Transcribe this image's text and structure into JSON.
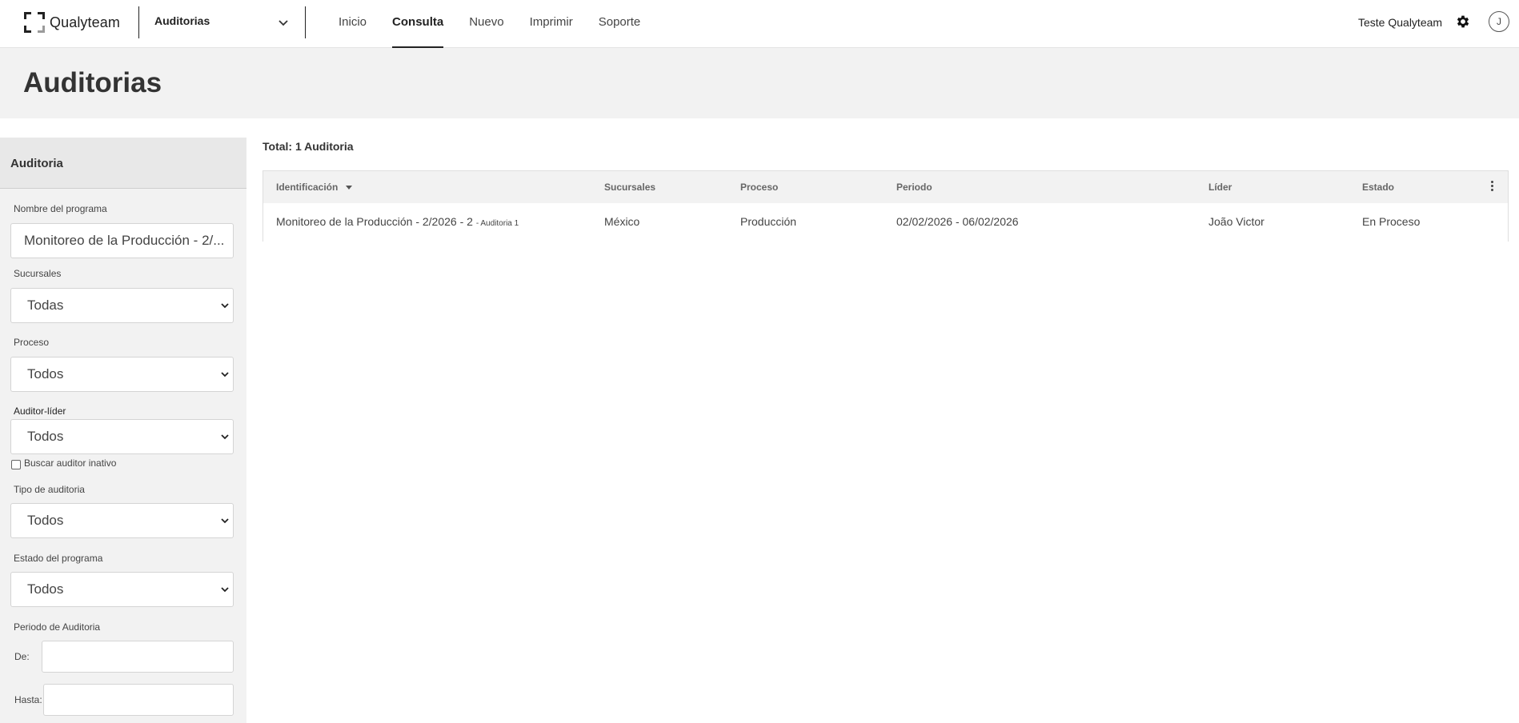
{
  "header": {
    "brand": "Qualyteam",
    "module": "Auditorias",
    "nav": [
      {
        "label": "Inicio"
      },
      {
        "label": "Consulta"
      },
      {
        "label": "Nuevo"
      },
      {
        "label": "Imprimir"
      },
      {
        "label": "Soporte"
      }
    ],
    "active_nav": "Consulta",
    "user_name": "Teste Qualyteam",
    "avatar_initial": "J",
    "icons": {
      "settings": "gear-icon",
      "module_toggle": "chevron-down-icon"
    }
  },
  "page": {
    "title": "Auditorias"
  },
  "sidebar": {
    "title": "Auditoria",
    "program_name": {
      "label": "Nombre del programa",
      "value": "Monitoreo de la Producción - 2/..."
    },
    "branches": {
      "label": "Sucursales",
      "value": "Todas"
    },
    "process": {
      "label": "Proceso",
      "value": "Todos"
    },
    "lead_auditor": {
      "label": "Auditor-líder",
      "value": "Todos"
    },
    "inactive_auditor": {
      "label": "Buscar auditor inativo",
      "checked": false
    },
    "audit_type": {
      "label": "Tipo de auditoria",
      "value": "Todos"
    },
    "program_status": {
      "label": "Estado del programa",
      "value": "Todos"
    },
    "audit_period": {
      "label": "Periodo de Auditoria",
      "from_label": "De:",
      "to_label": "Hasta:",
      "from_value": "",
      "to_value": ""
    }
  },
  "results": {
    "total": "Total: 1 Auditoria",
    "columns": [
      "Identificación",
      "Sucursales",
      "Proceso",
      "Periodo",
      "Líder",
      "Estado"
    ],
    "sorted_column": "Identificación",
    "rows": [
      {
        "identification": "Monitoreo de la Producción - 2/2026 - 2",
        "identification_suffix": "- Auditoria 1",
        "branch": "México",
        "process": "Producción",
        "period": "02/02/2026 - 06/02/2026",
        "leader": "João Victor",
        "status": "En Proceso"
      }
    ]
  },
  "colors": {
    "header_bg": "#ffffff",
    "band_bg": "#f2f2f2",
    "text": "#333333",
    "accent": "#222222"
  }
}
